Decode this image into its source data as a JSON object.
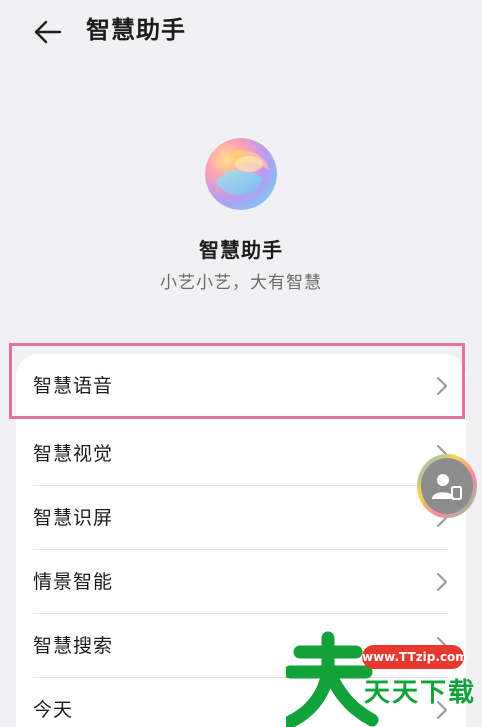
{
  "header": {
    "title": "智慧助手",
    "back_icon": "arrow-left-icon"
  },
  "hero": {
    "logo_icon": "xiaoyi-logo-icon",
    "name": "智慧助手",
    "slogan": "小艺小艺，大有智慧"
  },
  "menu": {
    "items": [
      {
        "label": "智慧语音",
        "icon": "chevron-right-icon",
        "highlighted": true
      },
      {
        "label": "智慧视觉",
        "icon": "chevron-right-icon"
      },
      {
        "label": "智慧识屏",
        "icon": "chevron-right-icon"
      },
      {
        "label": "情景智能",
        "icon": "chevron-right-icon"
      },
      {
        "label": "智慧搜索",
        "icon": "chevron-right-icon"
      },
      {
        "label": "今天",
        "icon": "chevron-right-icon"
      }
    ]
  },
  "float_ball": {
    "icon": "assistant-avatar-icon"
  },
  "watermark": {
    "url": "www.TTzip.com",
    "text": "天天下载"
  },
  "colors": {
    "background": "#f1f1f3",
    "card": "#ffffff",
    "highlight": "#e3739a",
    "watermark_green": "#12a23a",
    "watermark_red": "#e8392f"
  }
}
